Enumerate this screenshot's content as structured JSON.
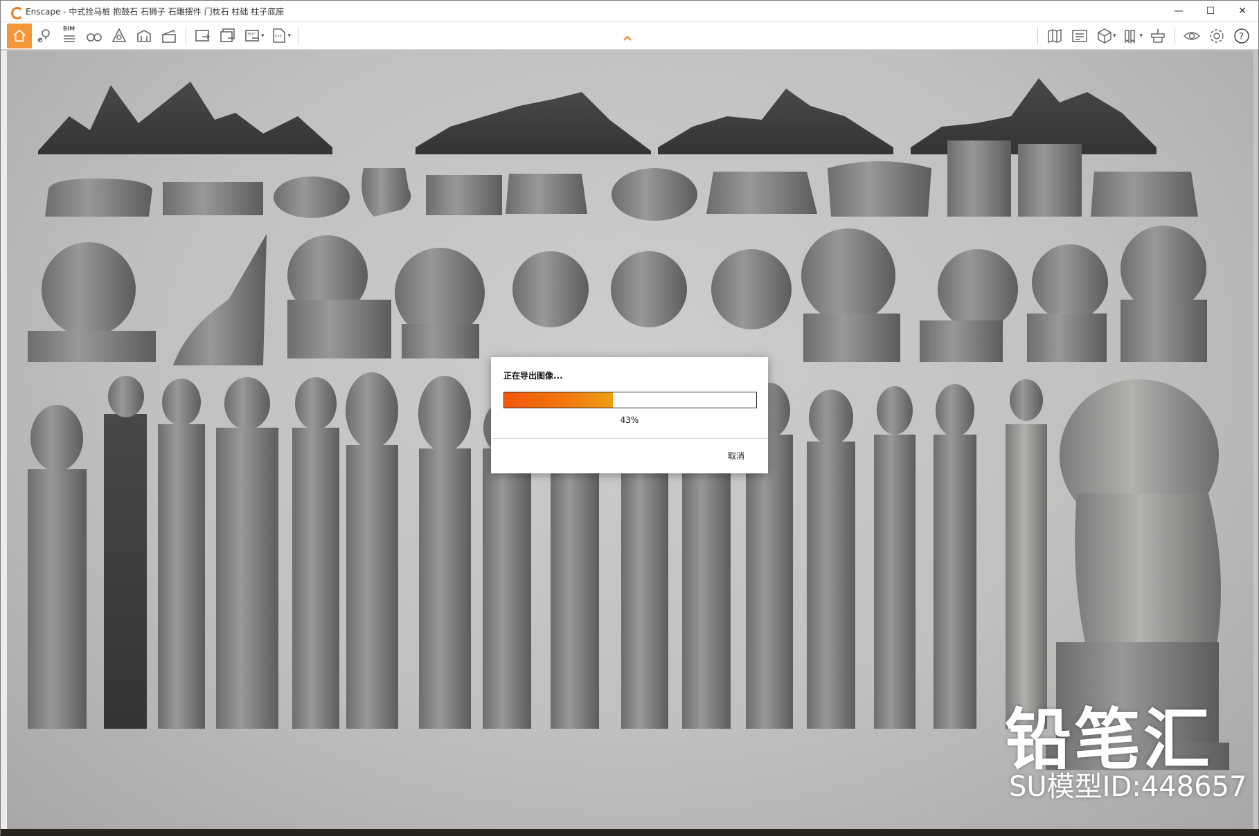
{
  "window": {
    "title": "Enscape - 中式拴马桩 抱鼓石 石狮子 石雕摆件 门枕石 柱础 柱子底座",
    "controls": {
      "minimize": "—",
      "maximize": "☐",
      "close": "✕"
    }
  },
  "toolbar": {
    "bim_label": "BIM",
    "left_icons": [
      "home-icon",
      "location-pin-icon",
      "bim-icon",
      "binoculars-icon",
      "capture-icon",
      "building-icon",
      "clapperboard-icon",
      "screenshot-icon",
      "batch-render-icon",
      "panorama-360-icon",
      "export-exe-icon"
    ],
    "right_icons": [
      "asset-library-icon",
      "material-editor-icon",
      "cube-views-icon",
      "bookmarks-icon",
      "upload-icon",
      "eye-icon",
      "settings-icon",
      "help-icon"
    ],
    "accent_color": "#f5953a"
  },
  "brand": {
    "name": "铅笔汇",
    "model_id": "SU模型ID:448657"
  },
  "dialog": {
    "title": "正在导出图像...",
    "progress": 0.43,
    "percent_text": "43%",
    "cancel_label": "取消"
  }
}
